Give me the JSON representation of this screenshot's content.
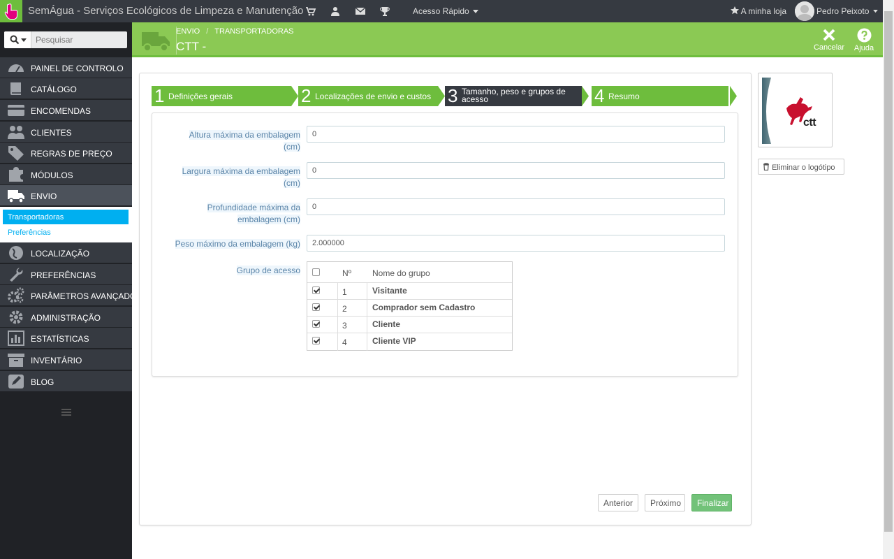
{
  "topbar": {
    "shop_title": "SemÁgua - Serviços Ecológicos de Limpeza e Manutenção",
    "quick_access": "Acesso Rápido",
    "my_store": "A minha loja",
    "user_name": "Pedro Peixoto"
  },
  "search": {
    "placeholder": "Pesquisar"
  },
  "sidebar": {
    "items": [
      {
        "label": "PAINEL DE CONTROLO"
      },
      {
        "label": "CATÁLOGO"
      },
      {
        "label": "ENCOMENDAS"
      },
      {
        "label": "CLIENTES"
      },
      {
        "label": "REGRAS DE PREÇO"
      },
      {
        "label": "MÓDULOS"
      },
      {
        "label": "ENVIO"
      },
      {
        "label": "LOCALIZAÇÃO"
      },
      {
        "label": "PREFERÊNCIAS"
      },
      {
        "label": "PARÂMETROS AVANÇADOS"
      },
      {
        "label": "ADMINISTRAÇÃO"
      },
      {
        "label": "ESTATÍSTICAS"
      },
      {
        "label": "INVENTÁRIO"
      },
      {
        "label": "BLOG"
      }
    ],
    "submenu": [
      "Transportadoras",
      "Preferências"
    ]
  },
  "header": {
    "breadcrumb_1": "ENVIO",
    "breadcrumb_sep": "/",
    "breadcrumb_2": "TRANSPORTADORAS",
    "title": "CTT -",
    "cancel_label": "Cancelar",
    "help_label": "Ajuda"
  },
  "wizard": {
    "steps": [
      {
        "num": "1",
        "label": "Definições gerais"
      },
      {
        "num": "2",
        "label": "Localizações de envio e custos"
      },
      {
        "num": "3",
        "label": "Tamanho, peso e grupos de acesso"
      },
      {
        "num": "4",
        "label": "Resumo"
      }
    ],
    "active_step": "3"
  },
  "form": {
    "height_label_1": "Altura máxima da embalagem",
    "height_label_2": "(cm)",
    "height_value": "0",
    "width_label_1": "Largura máxima da embalagem",
    "width_label_2": "(cm)",
    "width_value": "0",
    "depth_label_1": "Profundidade máxima da",
    "depth_label_2": "embalagem (cm)",
    "depth_value": "0",
    "weight_label": "Peso máximo da embalagem (kg)",
    "weight_value": "2.000000",
    "group_label": "Grupo de acesso"
  },
  "groups": {
    "col_num": "Nº",
    "col_name": "Nome do grupo",
    "rows": [
      {
        "id": "1",
        "name": "Visitante",
        "checked": true
      },
      {
        "id": "2",
        "name": "Comprador sem Cadastro",
        "checked": true
      },
      {
        "id": "3",
        "name": "Cliente",
        "checked": true
      },
      {
        "id": "4",
        "name": "Cliente VIP",
        "checked": true
      }
    ]
  },
  "buttons": {
    "previous": "Anterior",
    "next": "Próximo",
    "finish": "Finalizar"
  },
  "logo": {
    "brand_text": "ctt",
    "delete_label": "Eliminar o logótipo"
  },
  "colors": {
    "topbar": "#363a41",
    "header_green": "#8bc954",
    "step_green": "#6ebd3d",
    "step_active": "#363a41",
    "sidebar": "#202226",
    "accent_blue": "#00aff0",
    "finish_button": "#72c279"
  }
}
